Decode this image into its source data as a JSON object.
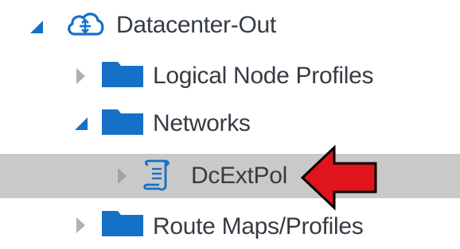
{
  "tree": {
    "items": [
      {
        "label": "Datacenter-Out",
        "icon": "cloud-icon",
        "expanded": true
      },
      {
        "label": "Logical Node Profiles",
        "icon": "folder-icon",
        "expanded": false
      },
      {
        "label": "Networks",
        "icon": "folder-icon",
        "expanded": true
      },
      {
        "label": "DcExtPol",
        "icon": "policy-document-icon",
        "expanded": false,
        "selected": true
      },
      {
        "label": "Route Maps/Profiles",
        "icon": "folder-icon",
        "expanded": false
      }
    ]
  },
  "annotation": {
    "icon": "red-arrow-icon",
    "color": "#e0141c"
  },
  "colors": {
    "accent": "#1570c8",
    "selection": "#c9c9c9",
    "twisty_collapsed": "#b0b0b0",
    "text": "#363c44"
  }
}
